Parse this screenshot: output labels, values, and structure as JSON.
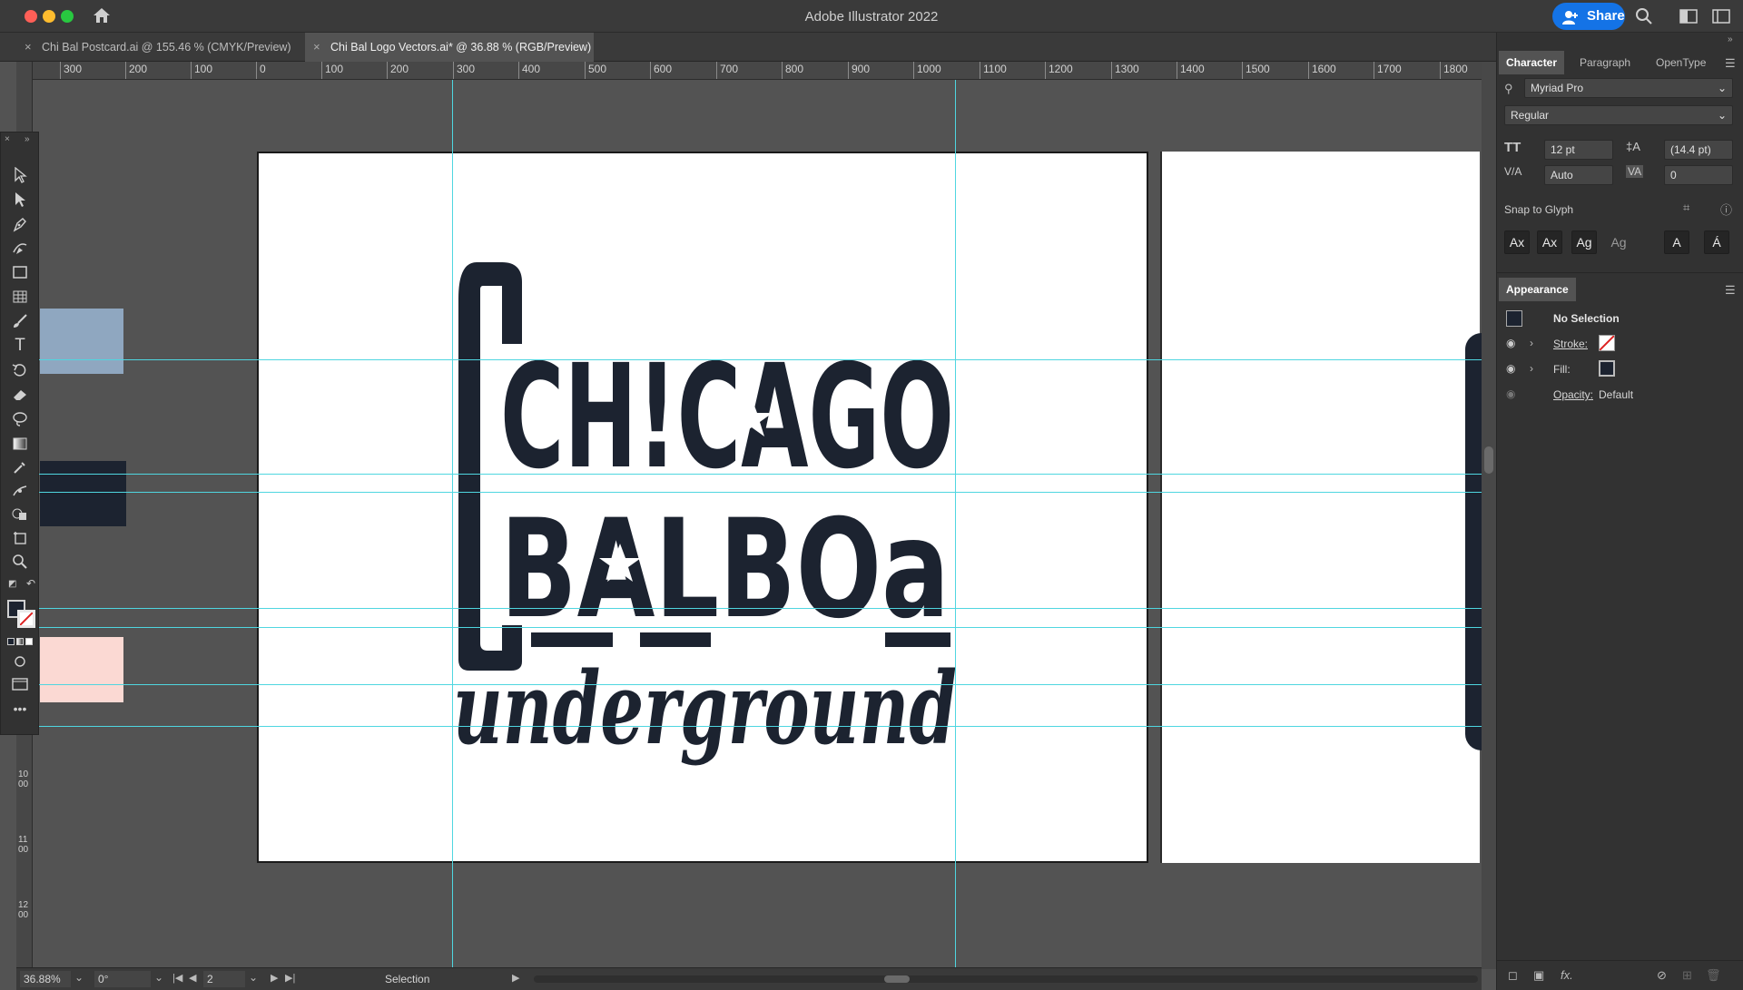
{
  "app": {
    "title": "Adobe Illustrator 2022",
    "share_label": "Share"
  },
  "tabs": [
    {
      "label": "Chi Bal Postcard.ai @ 155.46 % (CMYK/Preview)",
      "close": "×"
    },
    {
      "label": "Chi Bal Logo Vectors.ai* @ 36.88 % (RGB/Preview)",
      "close": "×"
    }
  ],
  "ruler": {
    "h_ticks": [
      "300",
      "200",
      "100",
      "0",
      "100",
      "200",
      "300",
      "400",
      "500",
      "600",
      "700",
      "800",
      "900",
      "1000",
      "1100",
      "1200",
      "1300",
      "1400",
      "1500",
      "1600",
      "1700",
      "1800"
    ],
    "v_ticks": [
      "1000",
      "1100",
      "1200"
    ]
  },
  "artwork": {
    "line1": "CH!CAGO",
    "line2": "BALBOa",
    "line3": "underground",
    "swatch_colors": [
      "#8fa7c0",
      "#1c2330",
      "#fbd9d3"
    ],
    "ink_color": "#1c2330"
  },
  "panel": {
    "tabs": [
      "Character",
      "Paragraph",
      "OpenType"
    ],
    "font_family": "Myriad Pro",
    "font_style": "Regular",
    "font_size": "12 pt",
    "leading": "(14.4 pt)",
    "kerning": "Auto",
    "tracking": "0",
    "snap_to_glyph": "Snap to Glyph",
    "glyph_buttons": [
      "Ax",
      "Ax",
      "Ag",
      "Ag",
      "A",
      "Á"
    ],
    "appearance_title": "Appearance",
    "no_selection": "No Selection",
    "stroke_label": "Stroke:",
    "fill_label": "Fill:",
    "opacity_label": "Opacity:",
    "opacity_value": "Default"
  },
  "status": {
    "zoom": "36.88%",
    "rotation": "0°",
    "artboard": "2",
    "tool": "Selection"
  }
}
